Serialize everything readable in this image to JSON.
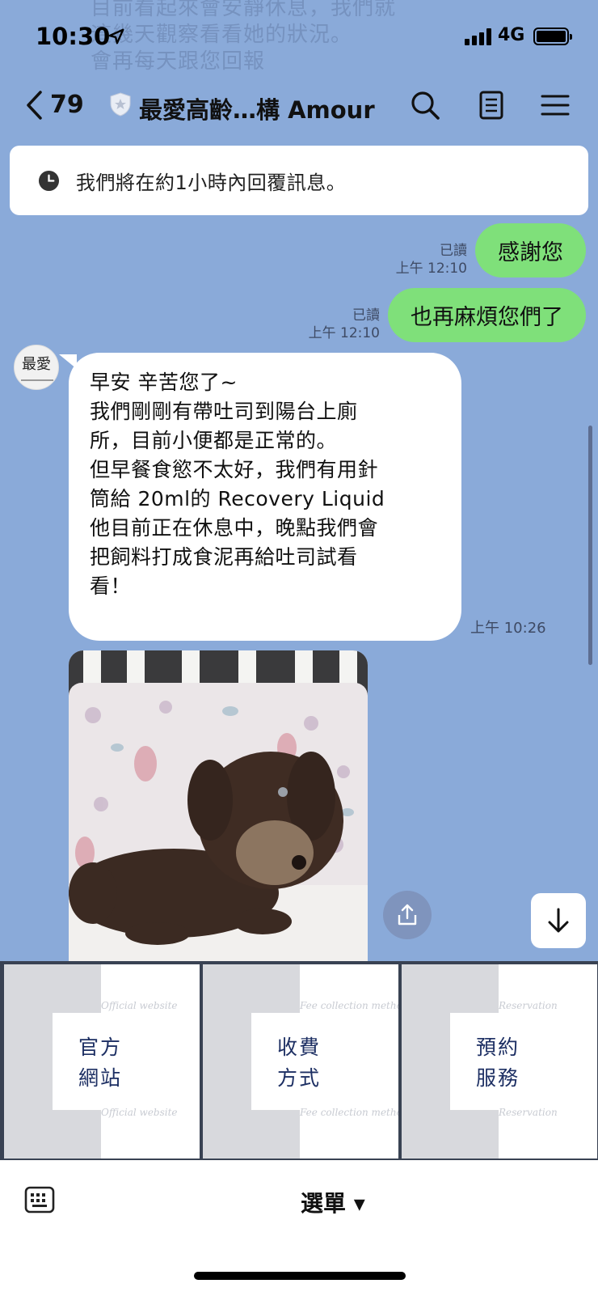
{
  "ghost_text": [
    "目前看起來會安靜休息，我們就",
    "這幾天觀察看看她的狀況。",
    "會再每天跟您回報"
  ],
  "status_bar": {
    "time": "10:30",
    "network": "4G"
  },
  "header": {
    "back_count": "79",
    "title": "最愛高齡…構 Amour"
  },
  "notice": {
    "text": "我們將在約1小時內回覆訊息。"
  },
  "messages_out": [
    {
      "status": "已讀",
      "time": "上午 12:10",
      "text": "感謝您"
    },
    {
      "status": "已讀",
      "time": "上午 12:10",
      "text": "也再麻煩您們了"
    }
  ],
  "avatar": {
    "text": "最愛"
  },
  "message_in": {
    "lines": [
      "早安 辛苦您了~",
      "我們剛剛有帶吐司到陽台上廁",
      "所，目前小便都是正常的。",
      "但早餐食慾不太好，我們有用針",
      "筒給 20ml的 Recovery Liquid",
      "他目前正在休息中，晚點我們會",
      "把飼料打成食泥再給吐司試看",
      "看！"
    ],
    "time": "上午 10:26"
  },
  "rich_menu": [
    {
      "line1": "官方",
      "line2": "網站",
      "script": "Official website"
    },
    {
      "line1": "收費",
      "line2": "方式",
      "script": "Fee collection method"
    },
    {
      "line1": "預約",
      "line2": "服務",
      "script": "Reservation"
    }
  ],
  "bottom_bar": {
    "menu_label": "選單 ▾"
  }
}
